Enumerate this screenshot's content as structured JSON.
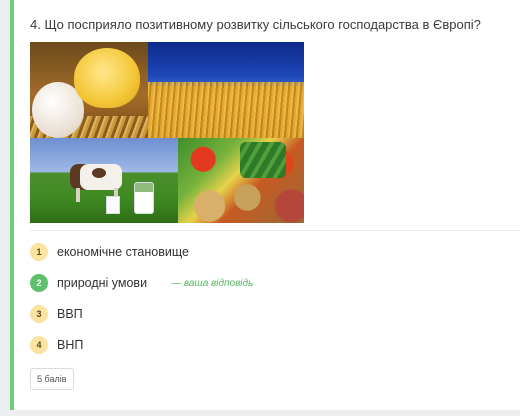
{
  "question": {
    "text": "4. Що посприяло позитивному розвитку сільського господарства в Європі?"
  },
  "image": {
    "tiles": [
      {
        "subject": "chick-and-egg"
      },
      {
        "subject": "wheat-field"
      },
      {
        "subject": "cow-and-milk"
      },
      {
        "subject": "vegetables"
      }
    ]
  },
  "options": [
    {
      "number": "1",
      "label": "економічне становище",
      "status": "neutral"
    },
    {
      "number": "2",
      "label": "природні умови",
      "status": "selected-correct",
      "note": "— ваша відповідь"
    },
    {
      "number": "3",
      "label": "ВВП",
      "status": "neutral"
    },
    {
      "number": "4",
      "label": "ВНП",
      "status": "neutral"
    }
  ],
  "points": {
    "label": "5 балів"
  },
  "colors": {
    "accent_green": "#5ec06c",
    "badge_yellow": "#fbe3a0",
    "answer_note": "#52b85f",
    "card_border": "#6fce7a"
  }
}
